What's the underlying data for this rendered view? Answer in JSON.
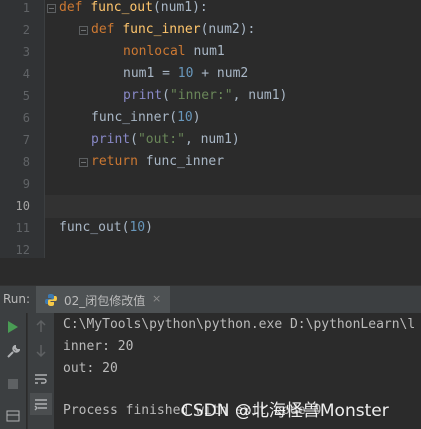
{
  "editor": {
    "line_numbers": [
      "1",
      "2",
      "3",
      "4",
      "5",
      "6",
      "7",
      "8",
      "9",
      "10",
      "11",
      "12"
    ],
    "current_line": "10",
    "lines": {
      "l1": {
        "kw": "def",
        "name": "func_out",
        "args": "(num1):"
      },
      "l2": {
        "kw": "def",
        "name": "func_inner",
        "args": "(num2):"
      },
      "l3": {
        "kw": "nonlocal",
        "rest": " num1"
      },
      "l4": {
        "pre": "num1 = ",
        "num": "10",
        "post": " + num2"
      },
      "l5": {
        "bi": "print",
        "open": "(",
        "str": "\"inner:\"",
        "post": ", num1)"
      },
      "l6": {
        "pre": "func_inner(",
        "num": "10",
        "post": ")"
      },
      "l7": {
        "bi": "print",
        "open": "(",
        "str": "\"out:\"",
        "post": ", num1)"
      },
      "l8": {
        "kw": "return",
        "rest": " func_inner"
      },
      "l11": {
        "pre": "func_out(",
        "num": "10",
        "post": ")"
      }
    }
  },
  "run": {
    "label": "Run:",
    "tab_label": "02_闭包修改值",
    "tab_close": "×",
    "tab_icon": "python-icon"
  },
  "console": {
    "lines": [
      "C:\\MyTools\\python\\python.exe D:\\pythonLearn\\l",
      "inner: 20",
      "out: 20",
      "",
      "Process finished with exit code 0"
    ]
  },
  "watermark": "CSDN @北海怪兽Monster",
  "colors": {
    "keyword": "#cc7832",
    "function": "#ffc66d",
    "builtin": "#8888c6",
    "string": "#6a8759",
    "number": "#6897bb",
    "background": "#2b2b2b"
  }
}
